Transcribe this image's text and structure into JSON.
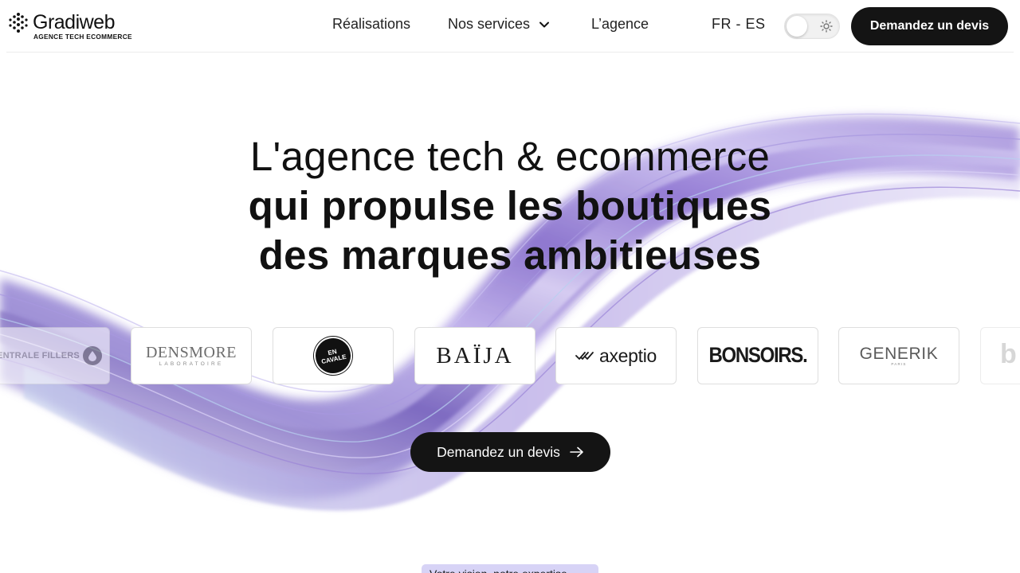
{
  "brand": {
    "name": "Gradiweb",
    "tagline": "AGENCE TECH ECOMMERCE"
  },
  "nav": {
    "items": [
      {
        "label": "Réalisations"
      },
      {
        "label": "Nos services",
        "icon": "chevron-down-icon"
      },
      {
        "label": "L’agence"
      }
    ],
    "language": "FR - ES",
    "theme_toggle": {
      "state": "light",
      "icon": "sun-icon"
    },
    "cta_label": "Demandez un devis"
  },
  "hero": {
    "line1": "L'agence tech & ecommerce",
    "line2": "qui propulse les boutiques",
    "line3": "des marques ambitieuses",
    "cta_label": "Demandez un devis",
    "cta_icon": "arrow-right-icon"
  },
  "clients": {
    "centrale": "ENTRALE FILLERS",
    "densmore": {
      "name": "DENSMORE",
      "sub": "LABORATOIRE"
    },
    "encavale": "EN CAVALE",
    "baija": "BAÏJA",
    "axeptio": "axeptio",
    "bonsoirs": "BONSOIRS.",
    "generik": {
      "name": "GENERIK",
      "sub": "PARIS"
    },
    "partial": "b"
  },
  "bottom_badge": "Votre vision, notre expertise",
  "colors": {
    "primary": "#141414",
    "accent": "#8b6fd6",
    "accent_light": "#d7d3f6",
    "background": "#ffffff"
  }
}
